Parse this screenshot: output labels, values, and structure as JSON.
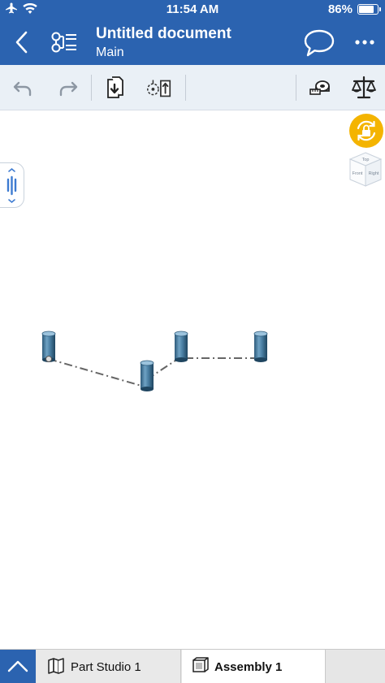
{
  "status": {
    "time": "11:54 AM",
    "battery": "86%",
    "battery_fraction": 0.86,
    "icons": [
      "airplane-icon",
      "wifi-icon",
      "battery-icon"
    ]
  },
  "header": {
    "title": "Untitled document",
    "subtitle": "Main",
    "icons": [
      "back-chevron-icon",
      "feature-tree-icon",
      "comment-icon",
      "more-icon"
    ]
  },
  "toolbar": {
    "icons": [
      "undo-icon",
      "redo-icon",
      "insert-icon",
      "mate-connector-icon",
      "measure-icon",
      "mass-properties-icon"
    ]
  },
  "canvas": {
    "view_cube_labels": {
      "top": "Top",
      "front": "Front",
      "right": "Right"
    }
  },
  "tabs": [
    {
      "label": "Part Studio 1",
      "icon": "part-studio-icon",
      "active": false
    },
    {
      "label": "Assembly 1",
      "icon": "assembly-icon",
      "active": true
    }
  ],
  "colors": {
    "brand_blue": "#2b63b0",
    "toolbar_bg": "#eaf0f6",
    "lock_yellow": "#f4b400",
    "part_blue": "#4a7fa3"
  }
}
